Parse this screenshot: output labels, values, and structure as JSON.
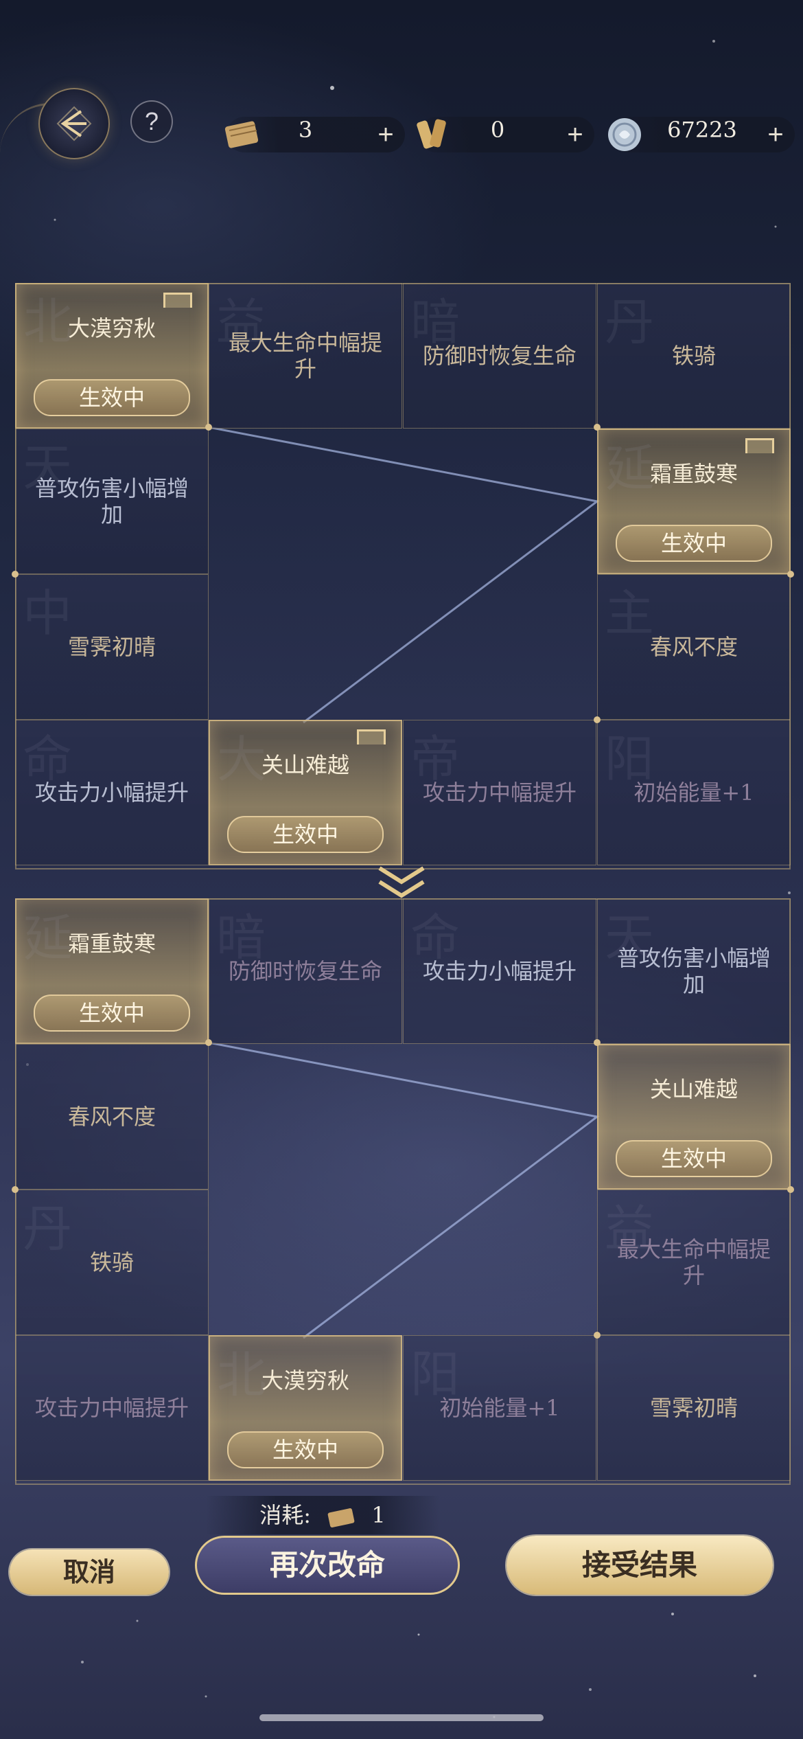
{
  "header": {
    "help_label": "?",
    "resources": [
      {
        "name": "scroll",
        "value": "3",
        "plus": "+"
      },
      {
        "name": "tokens",
        "value": "0",
        "plus": "+"
      },
      {
        "name": "jade-coin",
        "value": "67223",
        "plus": "+"
      }
    ]
  },
  "grids": [
    {
      "top": [
        "大漠穷秋",
        "最大生命中幅提升",
        "防御时恢复生命",
        "铁骑"
      ],
      "left": [
        "普攻伤害小幅增加",
        "雪霁初晴"
      ],
      "right": [
        "霜重鼓寒",
        "春风不度"
      ],
      "bottom": [
        "攻击力小幅提升",
        "关山难越",
        "攻击力中幅提升",
        "初始能量+1"
      ]
    },
    {
      "top": [
        "霜重鼓寒",
        "防御时恢复生命",
        "攻击力小幅提升",
        "普攻伤害小幅增加"
      ],
      "left": [
        "春风不度",
        "铁骑"
      ],
      "right": [
        "关山难越",
        "最大生命中幅提升"
      ],
      "bottom": [
        "攻击力中幅提升",
        "大漠穷秋",
        "初始能量+1",
        "雪霁初晴"
      ]
    }
  ],
  "active_badge": "生效中",
  "footer": {
    "cost_label": "消耗:",
    "cost_value": "1",
    "cancel_label": "取消",
    "reroll_label": "再次改命",
    "accept_label": "接受结果"
  }
}
